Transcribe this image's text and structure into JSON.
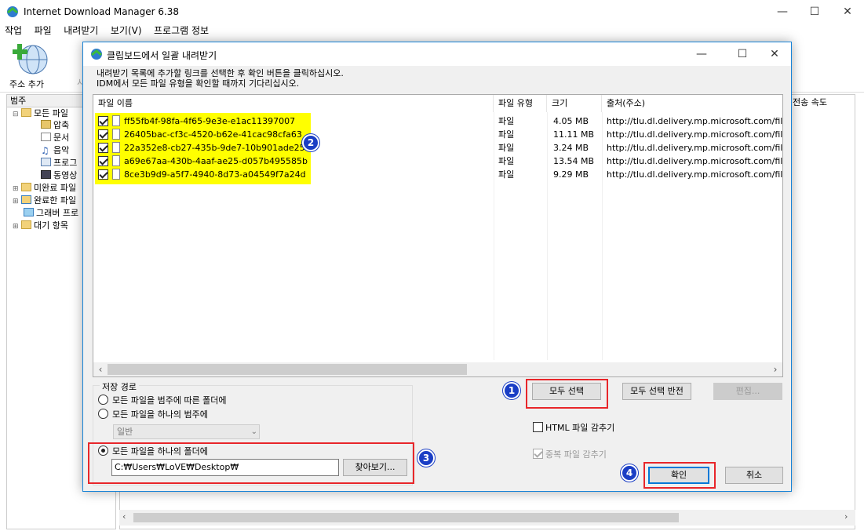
{
  "main": {
    "title": "Internet Download Manager 6.38",
    "menu": [
      "작업",
      "파일",
      "내려받기",
      "보기(V)",
      "프로그램 정보"
    ],
    "toolbar": {
      "add_url": "주소 추가",
      "partial_next": "시"
    },
    "category_header": "범주",
    "tree": [
      {
        "label": "모든 파일",
        "icon": "folder-open-icon"
      },
      {
        "label": "압축",
        "icon": "archive-icon"
      },
      {
        "label": "문서",
        "icon": "document-icon"
      },
      {
        "label": "음악",
        "icon": "music-icon"
      },
      {
        "label": "프로그",
        "icon": "program-icon"
      },
      {
        "label": "동영상",
        "icon": "video-icon"
      },
      {
        "label": "미완료 파일",
        "icon": "incomplete-folder-icon"
      },
      {
        "label": "완료한 파일",
        "icon": "complete-folder-icon"
      },
      {
        "label": "그래버 프로",
        "icon": "grabber-icon"
      },
      {
        "label": "대기 항목",
        "icon": "queue-folder-icon"
      }
    ],
    "list_header_speed": "전송 속도"
  },
  "dialog": {
    "title": "클립보드에서 일괄 내려받기",
    "message_line1": "내려받기 목록에 추가할 링크를 선택한 후 확인 버튼을 클릭하십시오.",
    "message_line2": "IDM에서 모든 파일 유형을 확인할 때까지 기다리십시오.",
    "columns": [
      "파일 이름",
      "파일 유형",
      "크기",
      "출처(주소)"
    ],
    "files": [
      {
        "name": "ff55fb4f-98fa-4f65-9e3e-e1ac11397007",
        "type": "파일",
        "size": "4.05 MB",
        "source": "http://tlu.dl.delivery.mp.microsoft.com/filestre"
      },
      {
        "name": "26405bac-cf3c-4520-b62e-41cac98cfa63",
        "type": "파일",
        "size": "11.11 MB",
        "source": "http://tlu.dl.delivery.mp.microsoft.com/filestre"
      },
      {
        "name": "22a352e8-cb27-435b-9de7-10b901ade258",
        "type": "파일",
        "size": "3.24 MB",
        "source": "http://tlu.dl.delivery.mp.microsoft.com/filestre"
      },
      {
        "name": "a69e67aa-430b-4aaf-ae25-d057b495585b",
        "type": "파일",
        "size": "13.54 MB",
        "source": "http://tlu.dl.delivery.mp.microsoft.com/filestre"
      },
      {
        "name": "8ce3b9d9-a5f7-4940-8d73-a04549f7a24d",
        "type": "파일",
        "size": "9.29 MB",
        "source": "http://tlu.dl.delivery.mp.microsoft.com/filestre"
      }
    ],
    "save_path": {
      "legend": "저장 경로",
      "option1": "모든 파일을 범주에 따른 폴더에",
      "option2": "모든 파일을 하나의 범주에",
      "category_value": "일반",
      "option3": "모든 파일을 하나의 폴더에",
      "path_value": "C:₩Users₩LoVE₩Desktop₩",
      "browse": "찾아보기..."
    },
    "buttons": {
      "select_all": "모두 선택",
      "invert": "모두 선택 반전",
      "edit": "편집...",
      "ok": "확인",
      "cancel": "취소"
    },
    "checkboxes": {
      "hide_html": "HTML 파일 감추기",
      "hide_duplicates": "중복 파일 감추기"
    },
    "badges": [
      "1",
      "2",
      "3",
      "4"
    ],
    "colors": {
      "highlight": "#ffff00",
      "annotation_red": "#e8262a",
      "badge_blue": "#1a3ec5",
      "title_accent": "#1883d7"
    }
  }
}
